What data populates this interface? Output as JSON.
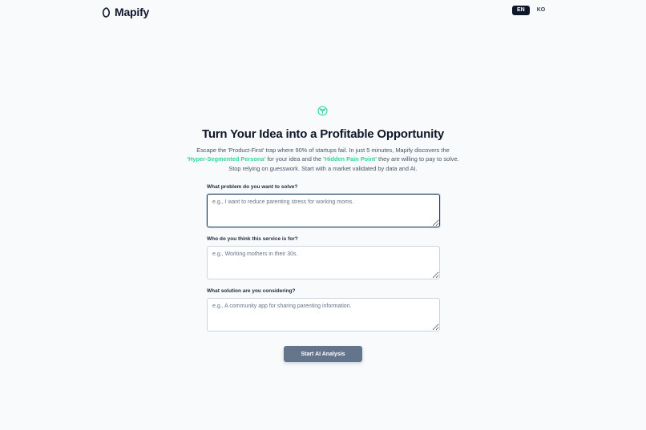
{
  "brand": {
    "name": "Mapify",
    "logo_icon": "leaf-ring-icon"
  },
  "language": {
    "options": [
      "EN",
      "KO"
    ],
    "selected": "EN"
  },
  "hero": {
    "icon": "sprout-icon",
    "title": "Turn Your Idea into a Profitable Opportunity",
    "desc_1": "Escape the 'Product-First' trap where 90% of startups fail. In just 5 minutes, Mapify discovers the",
    "highlight_persona": "'Hyper-Segmented Persona'",
    "desc_2": " for your idea and the ",
    "highlight_pain": "'Hidden Pain Point'",
    "desc_3": " they are willing to pay to solve. Stop relying on guesswork. Start with a market validated by data and AI."
  },
  "form": {
    "problem": {
      "label": "What problem do you want to solve?",
      "placeholder": "e.g., I want to reduce parenting stress for working moms.",
      "value": ""
    },
    "audience": {
      "label": "Who do you think this service is for?",
      "placeholder": "e.g., Working mothers in their 30s.",
      "value": ""
    },
    "solution": {
      "label": "What solution are you considering?",
      "placeholder": "e.g., A community app for sharing parenting information.",
      "value": ""
    },
    "submit_label": "Start AI Analysis"
  },
  "colors": {
    "accent": "#34d399",
    "dark": "#0f172a",
    "button": "#64748b",
    "background": "#f8fafc"
  }
}
